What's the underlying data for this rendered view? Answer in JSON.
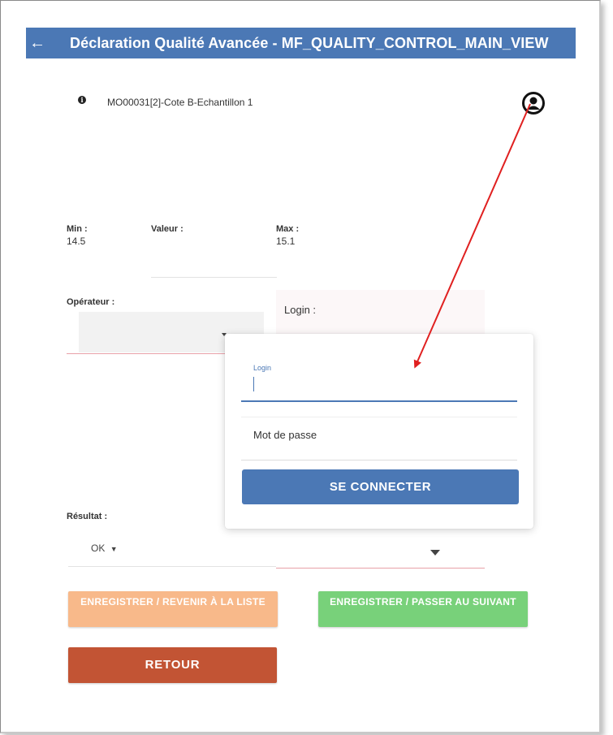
{
  "header": {
    "back_icon": "arrow-left-icon",
    "title": "Déclaration Qualité Avancée - MF_QUALITY_CONTROL_MAIN_VIEW",
    "background_color": "#4b78b5"
  },
  "info": {
    "icon": "info-icon",
    "text": "MO00031[2]-Cote B-Echantillon 1"
  },
  "user_icon": "user-account-icon",
  "measure": {
    "min_label": "Min :",
    "min_value": "14.5",
    "valeur_label": "Valeur :",
    "max_label": "Max :",
    "max_value": "15.1"
  },
  "operator": {
    "label": "Opérateur :"
  },
  "login_field_label": "Login :",
  "popup": {
    "login_label": "Login",
    "password_placeholder": "Mot de passe",
    "connect_button": "SE CONNECTER"
  },
  "result": {
    "label": "Résultat :",
    "value": "OK"
  },
  "buttons": {
    "save_back_list": "ENREGISTRER / REVENIR À LA LISTE",
    "save_next": "ENREGISTRER / PASSER AU SUIVANT",
    "retour": "RETOUR"
  },
  "colors": {
    "primary": "#4b78b5",
    "save_back_list": "#f8b98a",
    "save_next": "#78d17a",
    "retour": "#c25434",
    "annotation_arrow": "#e02020"
  }
}
